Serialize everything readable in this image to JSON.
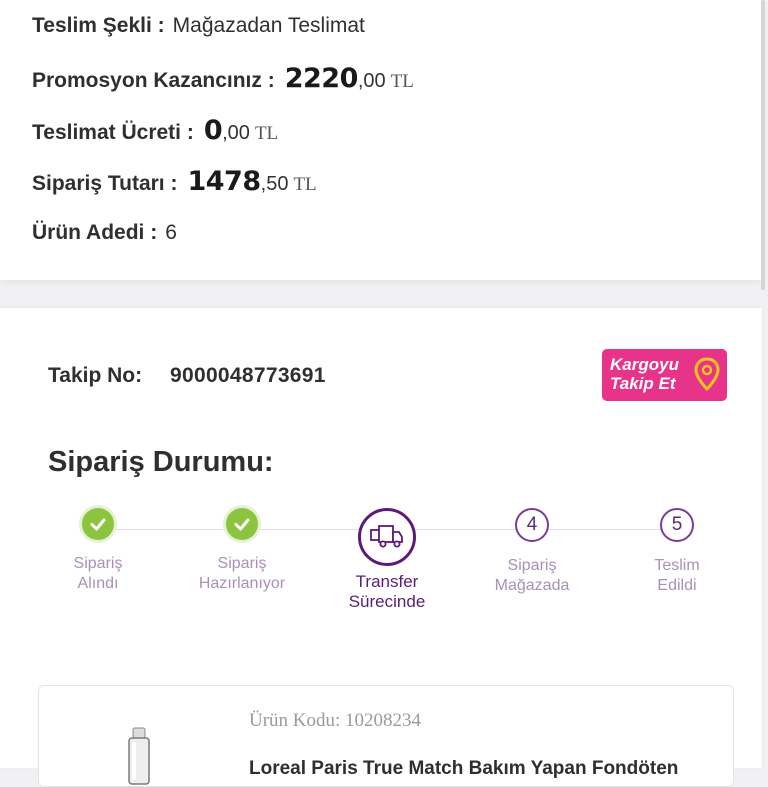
{
  "summary": {
    "delivery_label": "Teslim Şekli :",
    "delivery_value": "Mağazadan Teslimat",
    "promo_label": "Promosyon Kazancınız :",
    "promo_int": "2220",
    "promo_dec": ",00",
    "shipping_label": "Teslimat Ücreti :",
    "shipping_int": "0",
    "shipping_dec": ",00",
    "total_label": "Sipariş Tutarı :",
    "total_int": "1478",
    "total_dec": ",50",
    "currency": "TL",
    "count_label": "Ürün Adedi :",
    "count_value": "6"
  },
  "tracking": {
    "label": "Takip No:",
    "number": "9000048773691",
    "button_line1": "Kargoyu",
    "button_line2": "Takip Et"
  },
  "status": {
    "title": "Sipariş Durumu:",
    "steps": [
      {
        "line1": "Sipariş",
        "line2": "Alındı",
        "state": "done"
      },
      {
        "line1": "Sipariş",
        "line2": "Hazırlanıyor",
        "state": "done"
      },
      {
        "line1": "Transfer",
        "line2": "Sürecinde",
        "state": "active"
      },
      {
        "line1": "Sipariş",
        "line2": "Mağazada",
        "state": "pending",
        "number": "4"
      },
      {
        "line1": "Teslim",
        "line2": "Edildi",
        "state": "pending",
        "number": "5"
      }
    ]
  },
  "product": {
    "code": "Ürün Kodu: 10208234",
    "name": "Loreal Paris True Match Bakım Yapan Fondöten"
  },
  "colors": {
    "accent_purple": "#5e1a7a",
    "done_green": "#8bc53f",
    "button_pink": "#e8338a",
    "pin_yellow": "#f5c518"
  },
  "icons": {
    "check": "check-icon",
    "truck": "delivery-truck-icon",
    "pin": "map-pin-icon"
  }
}
